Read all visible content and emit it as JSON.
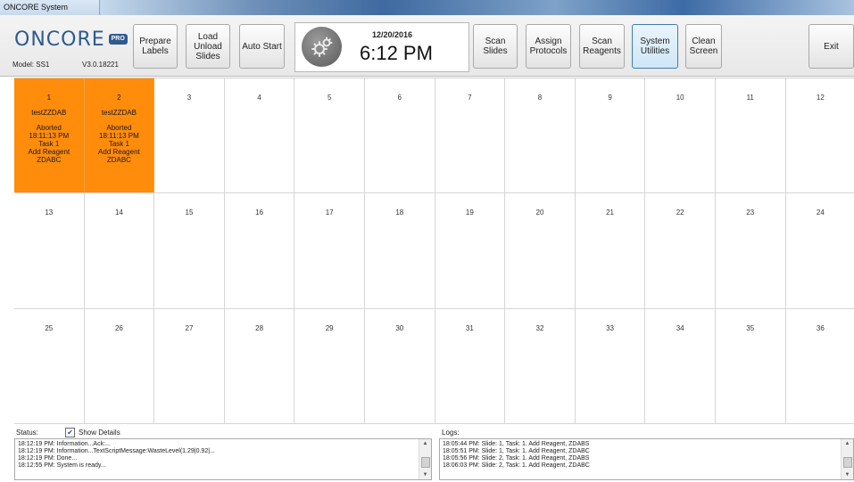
{
  "window": {
    "title": "ONCORE System Software"
  },
  "header": {
    "logo_text": "ONCORE",
    "logo_badge": "PRO",
    "model": "Model: SS1",
    "version": "V3.0.18221",
    "date": "12/20/2016",
    "time": "6:12 PM"
  },
  "toolbar": {
    "prepare_labels": "Prepare\nLabels",
    "load_unload": "Load\nUnload\nSlides",
    "auto_start": "Auto Start",
    "scan_slides": "Scan\nSlides",
    "assign_protocols": "Assign\nProtocols",
    "scan_reagents": "Scan\nReagents",
    "system_utilities": "System\nUtilities",
    "clean_screen": "Clean\nScreen",
    "exit": "Exit"
  },
  "slides": [
    {
      "number": "1",
      "name": "testZZDAB",
      "lines": [
        "Aborted",
        "18:11:13 PM",
        "Task 1",
        "Add Reagent",
        "ZDABC"
      ],
      "state": "aborted"
    },
    {
      "number": "2",
      "name": "testZZDAB",
      "lines": [
        "Aborted",
        "18:11:13 PM",
        "Task 1",
        "Add Reagent",
        "ZDABC"
      ],
      "state": "aborted"
    },
    {
      "number": "3"
    },
    {
      "number": "4"
    },
    {
      "number": "5"
    },
    {
      "number": "6"
    },
    {
      "number": "7"
    },
    {
      "number": "8"
    },
    {
      "number": "9"
    },
    {
      "number": "10"
    },
    {
      "number": "11"
    },
    {
      "number": "12"
    },
    {
      "number": "13"
    },
    {
      "number": "14"
    },
    {
      "number": "15"
    },
    {
      "number": "16"
    },
    {
      "number": "17"
    },
    {
      "number": "18"
    },
    {
      "number": "19"
    },
    {
      "number": "20"
    },
    {
      "number": "21"
    },
    {
      "number": "22"
    },
    {
      "number": "23"
    },
    {
      "number": "24"
    },
    {
      "number": "25"
    },
    {
      "number": "26"
    },
    {
      "number": "27"
    },
    {
      "number": "28"
    },
    {
      "number": "29"
    },
    {
      "number": "30"
    },
    {
      "number": "31"
    },
    {
      "number": "32"
    },
    {
      "number": "33"
    },
    {
      "number": "34"
    },
    {
      "number": "35"
    },
    {
      "number": "36"
    }
  ],
  "status": {
    "label": "Status:",
    "show_details_label": "Show Details",
    "show_details_checked": true,
    "lines": [
      "18:12:19 PM: Information...Ack:...",
      "18:12:19 PM: Information...TextScriptMessage:WasteLevel(1.29|0.92|...",
      "18:12:19 PM: Done...",
      "18:12:55 PM: System is ready..."
    ]
  },
  "logs": {
    "label": "Logs:",
    "lines": [
      "18:05:44 PM: Slide: 1, Task: 1. Add Reagent, ZDABS",
      "18:05:51 PM: Slide: 1, Task: 1. Add Reagent, ZDABC",
      "18:05:56 PM: Slide: 2, Task: 1. Add Reagent, ZDABS",
      "18:06:03 PM: Slide: 2, Task: 1. Add Reagent, ZDABC"
    ]
  },
  "colors": {
    "aborted": "#ff8c0a",
    "brand": "#2e5a8e",
    "active_border": "#3c7fb1"
  }
}
